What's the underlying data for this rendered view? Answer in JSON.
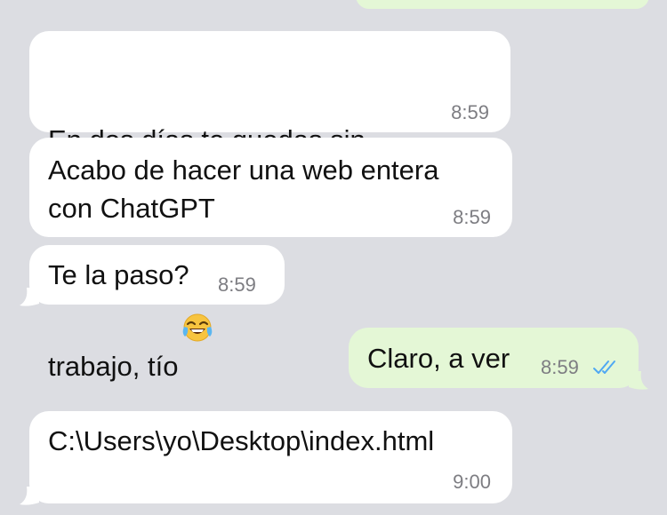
{
  "chat": {
    "messages": [
      {
        "id": "m1",
        "direction": "incoming",
        "text_line1": "En dos días te quedas sin",
        "text_line2": "trabajo, tío",
        "emoji": "face-with-tears-of-joy-icon",
        "time": "8:59"
      },
      {
        "id": "m2",
        "direction": "incoming",
        "text": "Acabo de hacer una web entera\ncon ChatGPT",
        "time": "8:59"
      },
      {
        "id": "m3",
        "direction": "incoming",
        "text": "Te la paso?",
        "time": "8:59"
      },
      {
        "id": "m4",
        "direction": "outgoing",
        "text": "Claro, a ver",
        "time": "8:59",
        "status": "read",
        "status_icon": "double-check-icon"
      },
      {
        "id": "m5",
        "direction": "incoming",
        "text": "C:\\Users\\yo\\Desktop\\index.html",
        "time": "9:00"
      }
    ]
  },
  "colors": {
    "background": "#dcdde2",
    "incoming_bubble": "#ffffff",
    "outgoing_bubble": "#e4f7d6",
    "timestamp": "#7d7d82",
    "read_receipt": "#4fa8f3"
  }
}
